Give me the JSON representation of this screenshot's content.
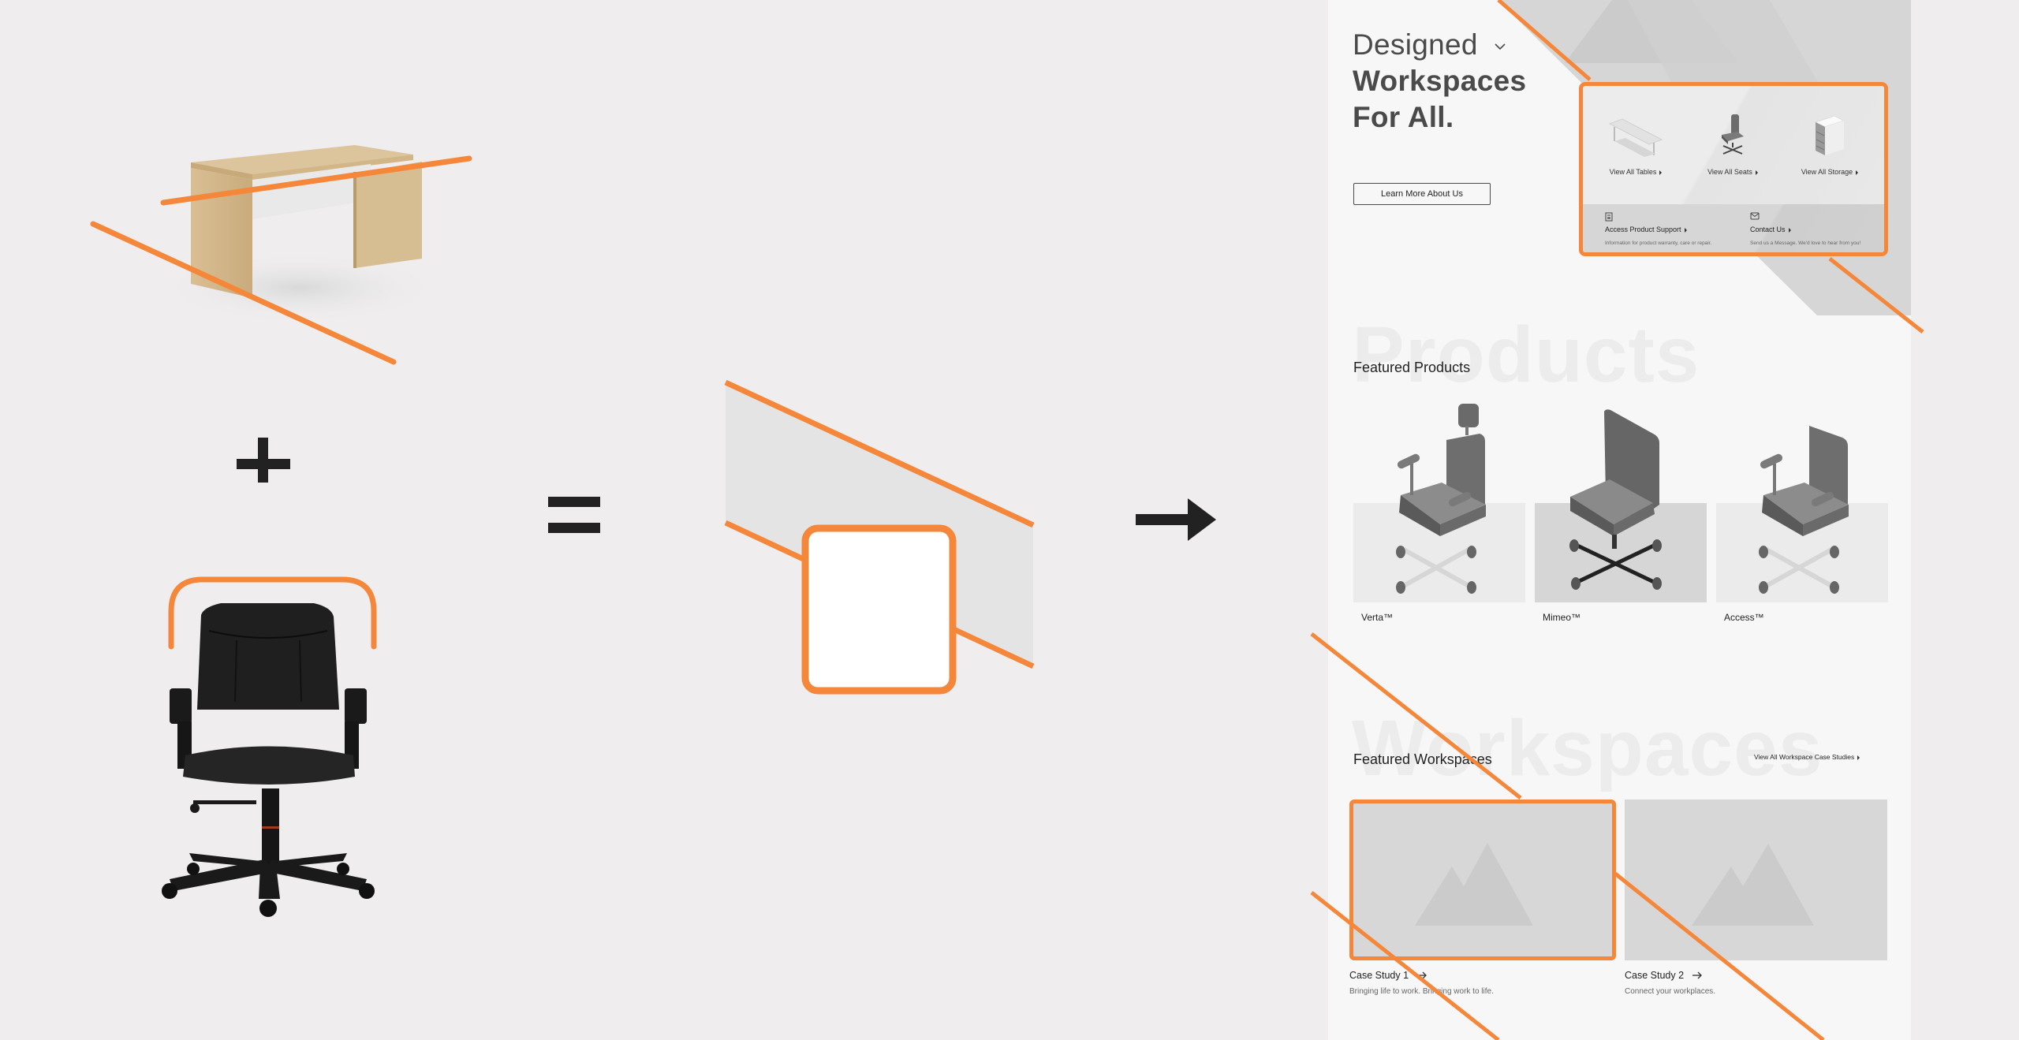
{
  "composition": {
    "operators": {
      "plus": "+",
      "equals": "=",
      "arrow": "→"
    },
    "items": [
      "desk-photo",
      "office-chair-photo",
      "wireframe-collage"
    ],
    "accent_color": "#f5873a",
    "operator_color": "#222222"
  },
  "site": {
    "hero": {
      "title_line1": "Designed",
      "title_line2": "Workspaces",
      "title_line3": "For All.",
      "cta_label": "Learn More About Us"
    },
    "nav_card": {
      "categories": [
        {
          "label": "View All Tables",
          "icon": "table-icon"
        },
        {
          "label": "View All Seats",
          "icon": "chair-icon"
        },
        {
          "label": "View All Storage",
          "icon": "storage-cabinet-icon"
        }
      ],
      "support": [
        {
          "title": "Access Product Support",
          "desc": "Information for product warranty, care or repair.",
          "icon": "manual-icon"
        },
        {
          "title": "Contact Us",
          "desc": "Send us a Message. We'd love to hear from you!",
          "icon": "mail-icon"
        }
      ]
    },
    "products": {
      "ghost": "Products",
      "title": "Featured Products",
      "items": [
        {
          "name": "Verta™"
        },
        {
          "name": "Mimeo™"
        },
        {
          "name": "Access™"
        }
      ]
    },
    "workspaces": {
      "ghost": "Workspaces",
      "title": "Featured Workspaces",
      "view_all": "View All Workspace Case Studies",
      "cases": [
        {
          "title": "Case Study 1",
          "desc": "Bringing life to work. Bringing work to life."
        },
        {
          "title": "Case Study 2",
          "desc": "Connect your workplaces."
        }
      ]
    }
  }
}
